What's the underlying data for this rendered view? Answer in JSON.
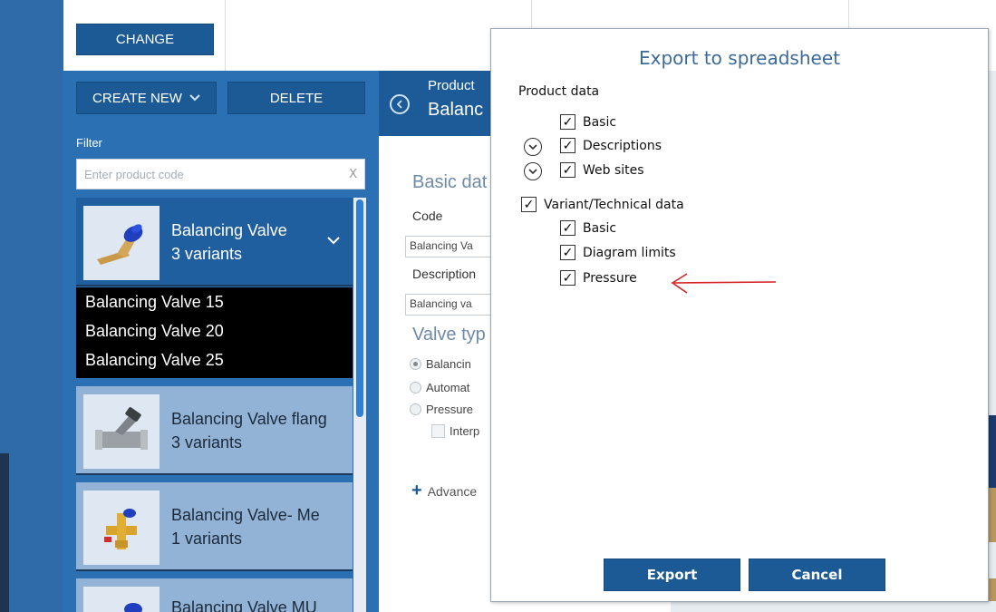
{
  "toolbar": {
    "change_label": "CHANGE"
  },
  "list": {
    "create_label": "CREATE NEW",
    "delete_label": "DELETE",
    "filter_label": "Filter",
    "filter_placeholder": "Enter product code",
    "clear_glyph": "X",
    "products": [
      {
        "name": "Balancing Valve",
        "variants": "3 variants",
        "selected": true
      },
      {
        "name": "Balancing Valve flang",
        "variants": "3 variants"
      },
      {
        "name": "Balancing Valve- Me",
        "variants": "1 variants"
      },
      {
        "name": "Balancing Valve MU",
        "variants": ""
      }
    ],
    "variant_rows": [
      "Balancing Valve 15",
      "Balancing Valve 20",
      "Balancing Valve 25"
    ]
  },
  "detail": {
    "kicker": "Product",
    "title": "Balanc",
    "basic_section": "Basic dat",
    "code_label": "Code",
    "code_value": "Balancing Va",
    "description_label": "Description",
    "description_value": "Balancing va",
    "valve_type_section": "Valve typ",
    "radios": [
      "Balancin",
      "Automat",
      "Pressure"
    ],
    "interp_label": "Interp",
    "advanced_label": "Advance"
  },
  "dialog": {
    "title": "Export to spreadsheet",
    "product_data_label": "Product data",
    "product_data_items": [
      "Basic",
      "Descriptions",
      "Web sites"
    ],
    "variant_label": "Variant/Technical data",
    "variant_items": [
      "Basic",
      "Diagram limits",
      "Pressure"
    ],
    "export_label": "Export",
    "cancel_label": "Cancel"
  },
  "colors": {
    "accent": "#1c5a96",
    "panel": "#2a70b2",
    "annotation_arrow": "#d42020"
  }
}
